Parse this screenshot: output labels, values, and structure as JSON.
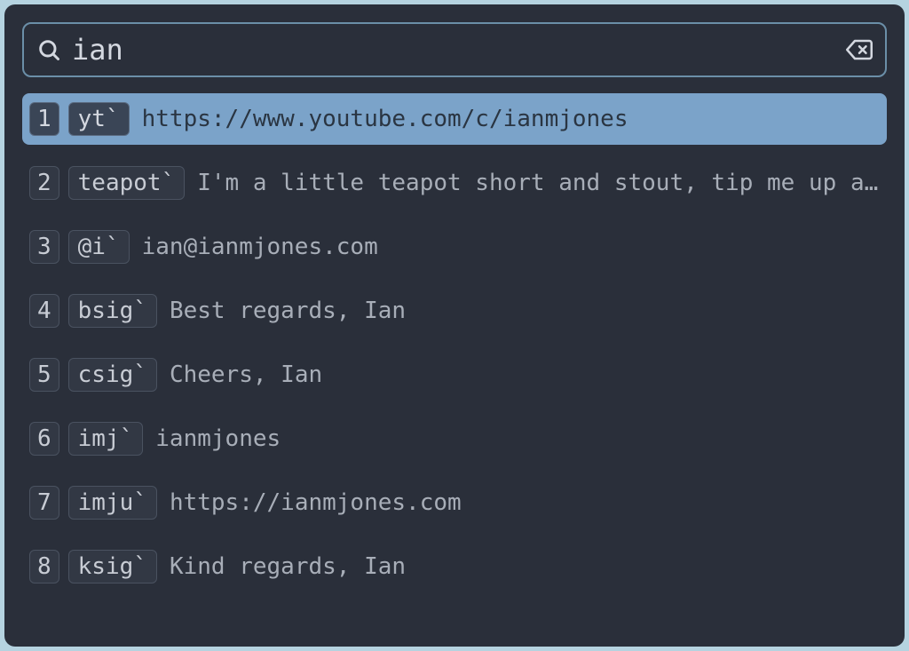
{
  "search": {
    "value": "ian",
    "placeholder": ""
  },
  "results": [
    {
      "index": "1",
      "key": "yt`",
      "text": "https://www.youtube.com/c/ianmjones",
      "selected": true
    },
    {
      "index": "2",
      "key": "teapot`",
      "text": "I'm a little teapot short and stout, tip me up and …",
      "selected": false
    },
    {
      "index": "3",
      "key": "@i`",
      "text": "ian@ianmjones.com",
      "selected": false
    },
    {
      "index": "4",
      "key": "bsig`",
      "text": "Best regards, Ian",
      "selected": false
    },
    {
      "index": "5",
      "key": "csig`",
      "text": "Cheers, Ian",
      "selected": false
    },
    {
      "index": "6",
      "key": "imj`",
      "text": "ianmjones",
      "selected": false
    },
    {
      "index": "7",
      "key": "imju`",
      "text": "https://ianmjones.com",
      "selected": false
    },
    {
      "index": "8",
      "key": "ksig`",
      "text": "Kind regards, Ian",
      "selected": false
    }
  ]
}
